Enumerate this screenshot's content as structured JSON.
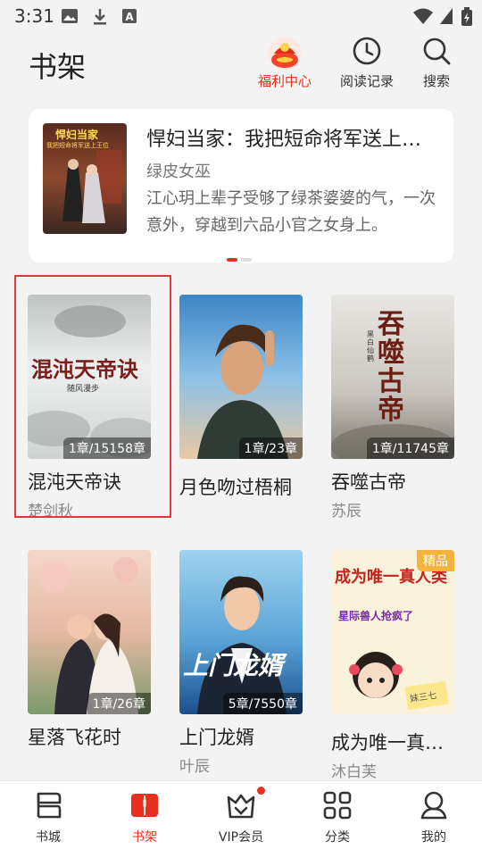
{
  "status_bar": {
    "time": "3:31"
  },
  "header": {
    "title": "书架",
    "actions": [
      {
        "label": "福利中心",
        "icon": "gift-pouch-icon",
        "active": true
      },
      {
        "label": "阅读记录",
        "icon": "clock-icon"
      },
      {
        "label": "搜索",
        "icon": "search-icon"
      }
    ]
  },
  "featured": {
    "cover_text_top": "悍妇当家",
    "cover_text_sub": "我把短命将军送上王位",
    "title": "悍妇当家：我把短命将军送上王位",
    "author": "绿皮女巫",
    "description": "江心玥上辈子受够了绿茶婆婆的气，一次意外，穿越到六品小官之女身上。",
    "page_dots": 2,
    "active_dot": 0
  },
  "books": [
    {
      "title": "混沌天帝诀",
      "author": "楚剑秋",
      "progress": "1章/15158章",
      "cover_text": "混沌天帝诀",
      "cover_sub": "随风漫步",
      "selected": true
    },
    {
      "title": "月色吻过梧桐",
      "author": "",
      "progress": "1章/23章",
      "cover_text": ""
    },
    {
      "title": "吞噬古帝",
      "author": "苏辰",
      "progress": "1章/11745章",
      "cover_text": "吞噬古帝",
      "cover_sub": "黑白仙鹤"
    },
    {
      "title": "星落飞花时",
      "author": "",
      "progress": "1章/26章",
      "cover_text": ""
    },
    {
      "title": "上门龙婿",
      "author": "叶辰",
      "progress": "5章/7550章",
      "cover_text": "上门龙婿"
    },
    {
      "title": "成为唯一真人类",
      "author": "沐白芙",
      "progress": "",
      "tag": "精品",
      "cover_text_a": "成为唯一真人类",
      "cover_text_b": "星际兽人抢疯了",
      "cover_sub": "妹三七"
    }
  ],
  "bottom_nav": [
    {
      "label": "书城",
      "icon": "bookstore-icon"
    },
    {
      "label": "书架",
      "icon": "bookshelf-icon",
      "active": true
    },
    {
      "label": "VIP会员",
      "icon": "vip-crown-icon",
      "dot": true
    },
    {
      "label": "分类",
      "icon": "category-grid-icon"
    },
    {
      "label": "我的",
      "icon": "profile-icon"
    }
  ],
  "colors": {
    "accent": "#e8301e",
    "background": "#f3f3f3",
    "tag": "#f3b33d"
  }
}
